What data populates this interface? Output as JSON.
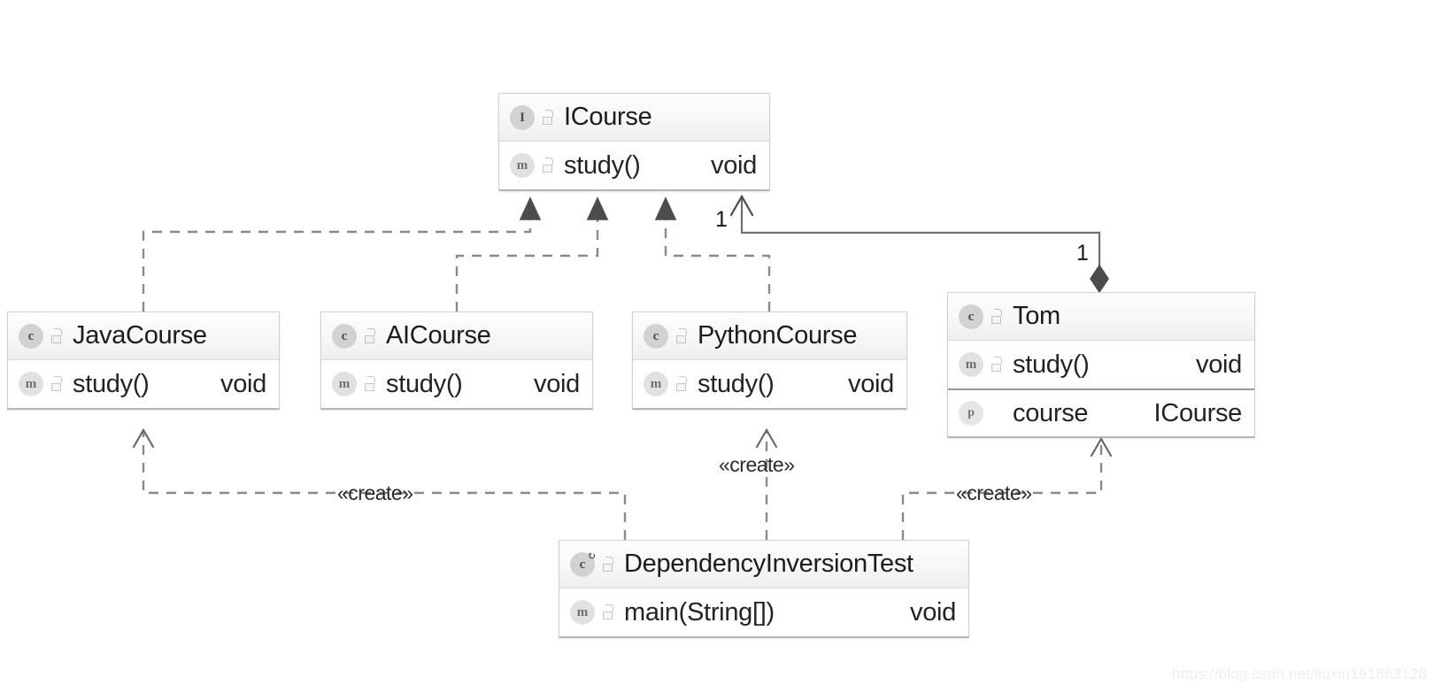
{
  "diagram": {
    "title": "Dependency Inversion UML Class Diagram",
    "watermark": "https://blog.csdn.net/liuxin191863128",
    "colors": {
      "line": "#6f6f6f",
      "dashed": "#8a8a8a",
      "box_border": "#d0d0d0",
      "header_bg": "#f4f4f4",
      "icon_bg": "#d2d2d2",
      "text": "#1c1c1c"
    }
  },
  "classes": {
    "icourse": {
      "stereotype_icon": "interface-icon",
      "name": "ICourse",
      "members": [
        {
          "icon": "method-icon",
          "visibility_icon": "unlock-icon",
          "name": "study()",
          "type": "void"
        }
      ]
    },
    "javacourse": {
      "stereotype_icon": "class-icon",
      "name": "JavaCourse",
      "members": [
        {
          "icon": "method-icon",
          "visibility_icon": "unlock-icon",
          "name": "study()",
          "type": "void"
        }
      ]
    },
    "aicourse": {
      "stereotype_icon": "class-icon",
      "name": "AICourse",
      "members": [
        {
          "icon": "method-icon",
          "visibility_icon": "unlock-icon",
          "name": "study()",
          "type": "void"
        }
      ]
    },
    "pythoncourse": {
      "stereotype_icon": "class-icon",
      "name": "PythonCourse",
      "members": [
        {
          "icon": "method-icon",
          "visibility_icon": "unlock-icon",
          "name": "study()",
          "type": "void"
        }
      ]
    },
    "tom": {
      "stereotype_icon": "class-icon",
      "name": "Tom",
      "members": [
        {
          "icon": "method-icon",
          "visibility_icon": "unlock-icon",
          "name": "study()",
          "type": "void"
        },
        {
          "icon": "property-icon",
          "visibility_icon": "none",
          "name": "course",
          "type": "ICourse"
        }
      ]
    },
    "test": {
      "stereotype_icon": "runnable-class-icon",
      "name": "DependencyInversionTest",
      "members": [
        {
          "icon": "static-method-icon",
          "visibility_icon": "unlock-icon",
          "name": "main(String[])",
          "type": "void"
        }
      ]
    }
  },
  "relationships": [
    {
      "id": "rel-java-icourse",
      "from": "JavaCourse",
      "to": "ICourse",
      "type": "realization",
      "style": "dashed",
      "arrow": "hollow-triangle"
    },
    {
      "id": "rel-ai-icourse",
      "from": "AICourse",
      "to": "ICourse",
      "type": "realization",
      "style": "dashed",
      "arrow": "hollow-triangle"
    },
    {
      "id": "rel-python-icourse",
      "from": "PythonCourse",
      "to": "ICourse",
      "type": "realization",
      "style": "dashed",
      "arrow": "hollow-triangle"
    },
    {
      "id": "rel-tom-icourse",
      "from": "Tom",
      "to": "ICourse",
      "type": "composition",
      "style": "solid",
      "arrow": "open-arrow",
      "source_multiplicity": "1",
      "target_multiplicity": "1"
    },
    {
      "id": "rel-test-java",
      "from": "DependencyInversionTest",
      "to": "JavaCourse",
      "type": "dependency",
      "style": "dashed",
      "arrow": "open-arrow",
      "label": "«create»"
    },
    {
      "id": "rel-test-python",
      "from": "DependencyInversionTest",
      "to": "PythonCourse",
      "type": "dependency",
      "style": "dashed",
      "arrow": "open-arrow",
      "label": "«create»"
    },
    {
      "id": "rel-test-tom",
      "from": "DependencyInversionTest",
      "to": "Tom",
      "type": "dependency",
      "style": "dashed",
      "arrow": "open-arrow",
      "label": "«create»"
    }
  ],
  "labels": {
    "mult_icourse_end": "1",
    "mult_tom_end": "1",
    "create_java": "«create»",
    "create_python": "«create»",
    "create_tom": "«create»"
  }
}
